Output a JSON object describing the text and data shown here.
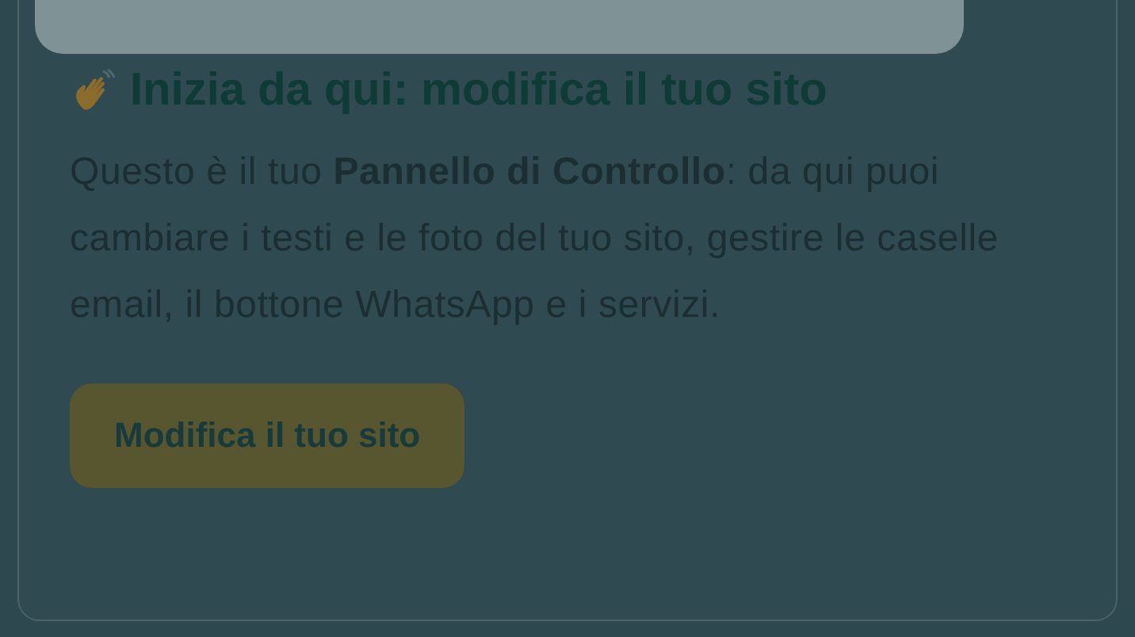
{
  "card": {
    "title": "Inizia da qui: modifica il tuo sito",
    "body": "Questo è il tuo **Pannello di Controllo**: da qui puoi cambiare i testi e le foto del tuo sito, gestire le caselle email, il bottone WhatsApp e i servizi.",
    "button": "Modifica il tuo sito"
  }
}
